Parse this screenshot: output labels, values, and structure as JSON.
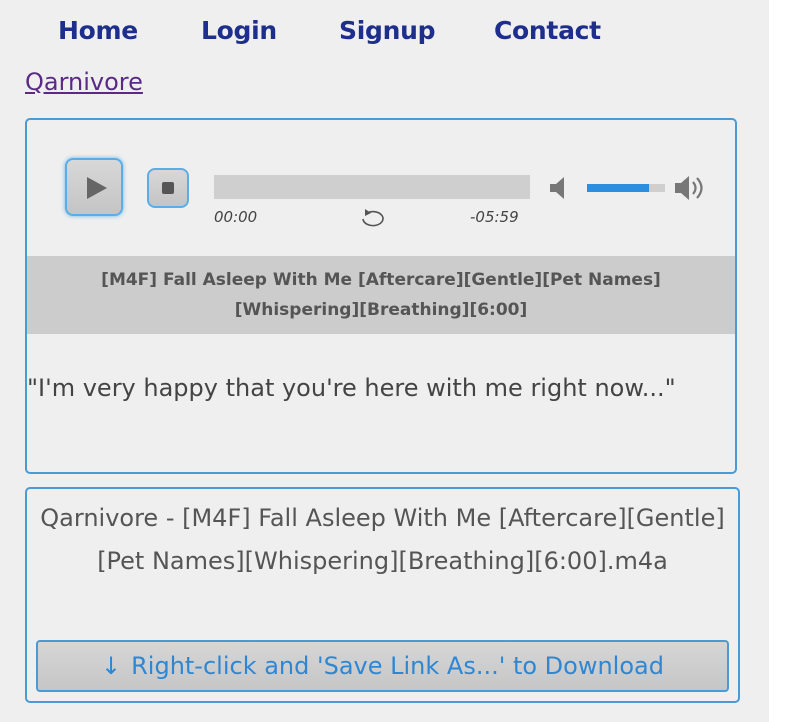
{
  "nav": {
    "items": [
      {
        "label": "Home"
      },
      {
        "label": "Login"
      },
      {
        "label": "Signup"
      },
      {
        "label": "Contact"
      }
    ]
  },
  "site_link": "Qarnivore",
  "player": {
    "current_time": "00:00",
    "remaining_time": "-05:59",
    "progress": 0,
    "volume": 0.8,
    "title": "[M4F] Fall Asleep With Me [Aftercare][Gentle][Pet Names][Whispering][Breathing][6:00]",
    "quote": "\"I'm very happy that you're here with me right now...\"",
    "icons": {
      "play": "play-icon",
      "stop": "stop-icon",
      "repeat": "repeat-icon",
      "mute": "volume-mute-icon",
      "max": "volume-max-icon"
    }
  },
  "file": {
    "name": "Qarnivore - [M4F] Fall Asleep With Me [Aftercare][Gentle][Pet Names][Whispering][Breathing][6:00].m4a",
    "download_label": "Right-click and 'Save Link As...' to Download",
    "download_icon": "download-arrow-icon"
  },
  "colors": {
    "nav": "#1d2e8c",
    "accent_border": "#4a9ad6",
    "download_text": "#2f87d4",
    "volume_fill": "#2b8ede"
  }
}
